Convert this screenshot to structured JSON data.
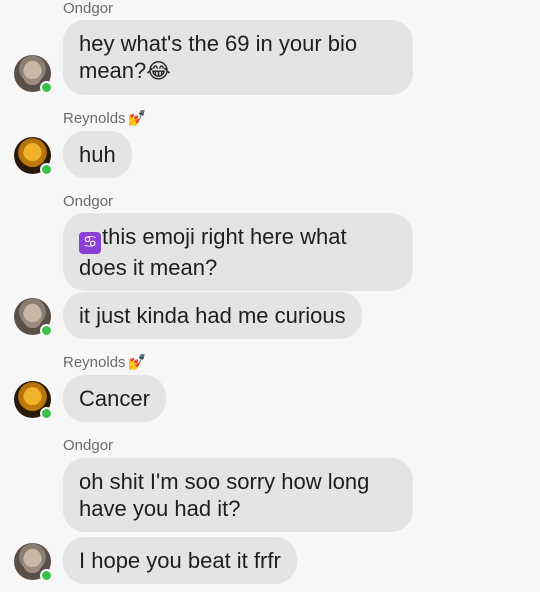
{
  "messages": [
    {
      "sender": "Ondgor",
      "text": "hey what's the 69 in your bio\nmean?",
      "emoji": "😂"
    },
    {
      "sender": "Reynolds",
      "sender_emoji": "💅",
      "text": "huh"
    },
    {
      "sender": "Ondgor",
      "icon": "♋",
      "text": "this emoji right here what\ndoes it mean?"
    },
    {
      "text": "it just kinda had me curious"
    },
    {
      "sender": "Reynolds",
      "sender_emoji": "💅",
      "text": "Cancer"
    },
    {
      "sender": "Ondgor",
      "text": "oh shit I'm soo sorry how long\nhave you had it?"
    },
    {
      "text": "I hope you beat it frfr"
    }
  ]
}
